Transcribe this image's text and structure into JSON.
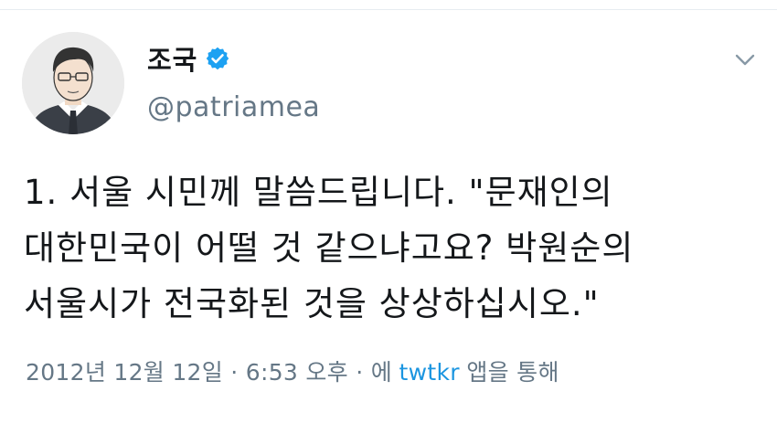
{
  "tweet": {
    "author": {
      "display_name": "조국",
      "handle": "@patriamea",
      "verified": true,
      "avatar_icon": "caricature-avatar-icon"
    },
    "menu_icon": "chevron-down-icon",
    "text": "1. 서울 시민께 말씀드립니다. \"문재인의\n대한민국이 어떨 것 같으냐고요? 박원순의\n서울시가 전국화된 것을 상상하십시오.\"",
    "timestamp": "2012년 12월 12일 · 6:53 오후 · 에",
    "via_app": "twtkr",
    "via_suffix": "앱을 통해"
  },
  "colors": {
    "text": "#14171a",
    "secondary": "#657786",
    "link": "#1b95e0",
    "verified_badge": "#1da1f2",
    "divider": "#e6ecf0"
  }
}
